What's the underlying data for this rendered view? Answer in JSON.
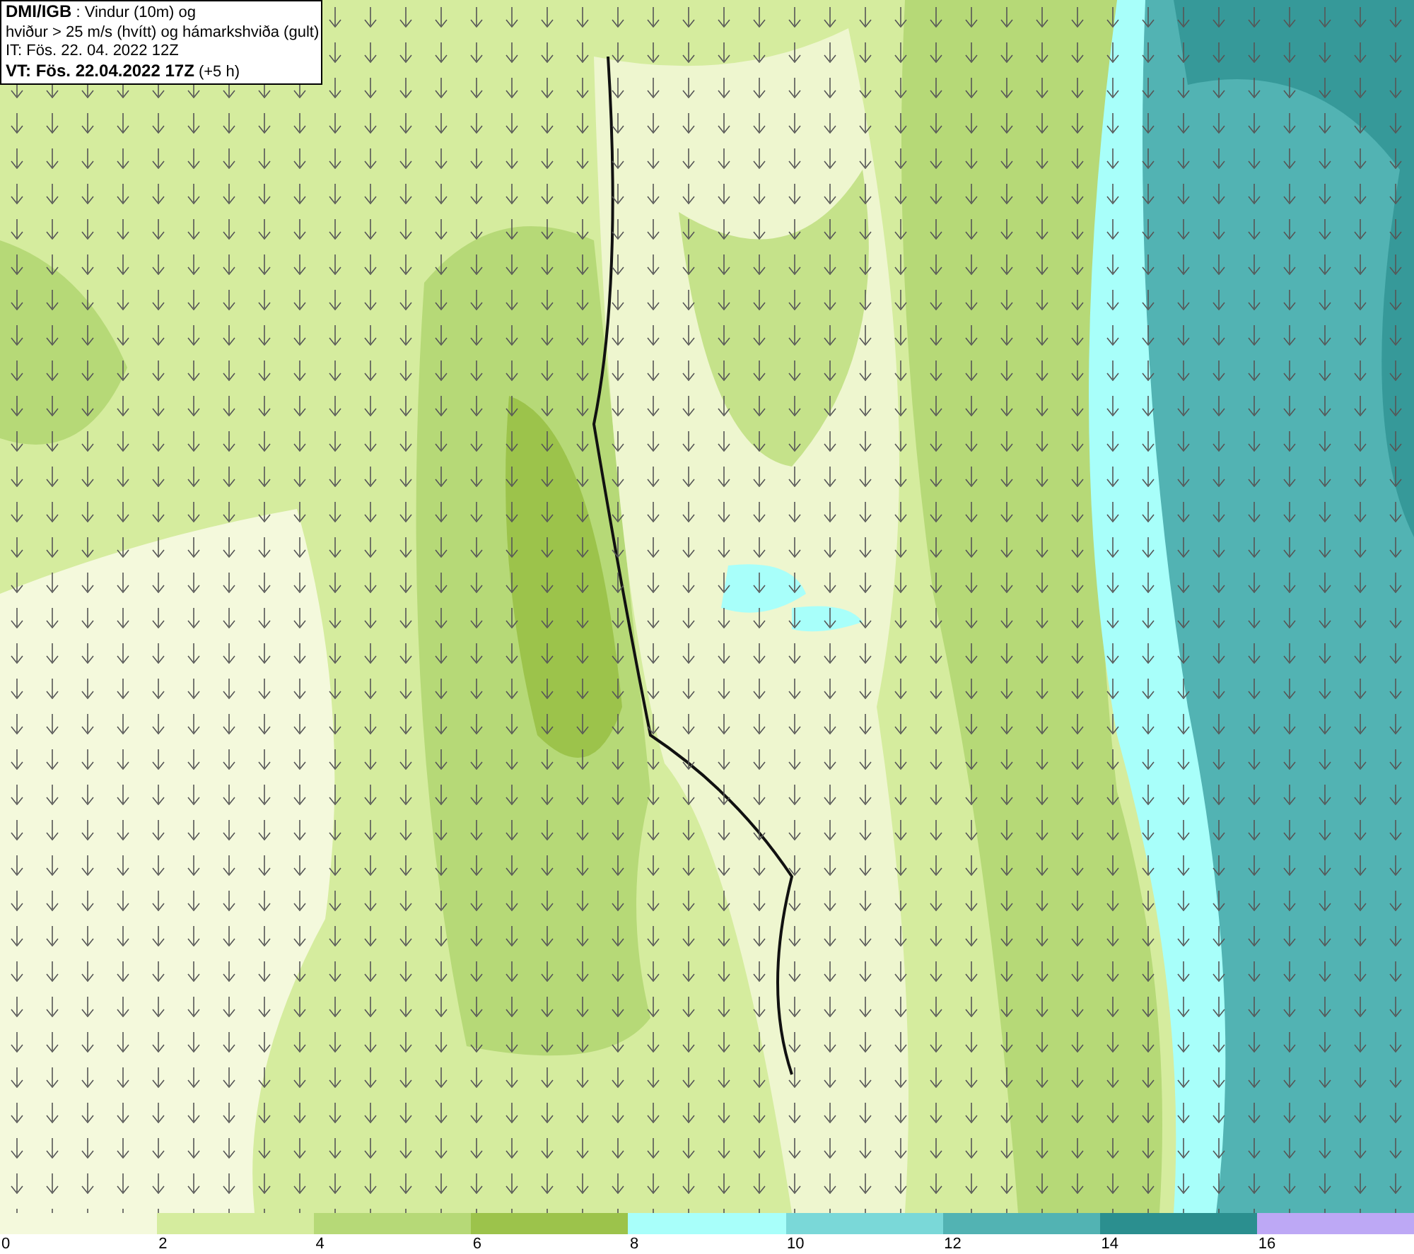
{
  "header": {
    "lines": [
      "**DMI/IGB** : Vindur (10m) og",
      "hviður > 25 m/s (hvítt) og hámarkshviða (gult)",
      "IT: Fös. 22. 04. 2022 12Z",
      "**VT: Fös. 22.04.2022 17Z** (+5 h)"
    ]
  },
  "legend": [
    {
      "label": "0",
      "color": "#f4f9dc"
    },
    {
      "label": "2",
      "color": "#d5ec9e"
    },
    {
      "label": "4",
      "color": "#b6d977"
    },
    {
      "label": "6",
      "color": "#9cc34b"
    },
    {
      "label": "8",
      "color": "#a8fffa"
    },
    {
      "label": "10",
      "color": "#7ad8d8"
    },
    {
      "label": "12",
      "color": "#52b3b3"
    },
    {
      "label": "14",
      "color": "#2b8f8f"
    },
    {
      "label": "16",
      "color": "#bda8f5"
    }
  ]
}
